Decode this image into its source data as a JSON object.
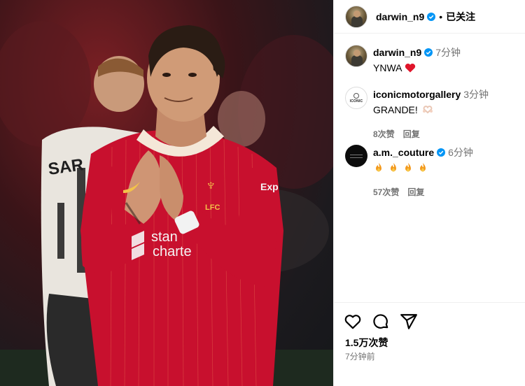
{
  "header": {
    "username": "darwin_n9",
    "separator": "•",
    "follow_state": "已关注"
  },
  "comments": [
    {
      "username": "darwin_n9",
      "time": "7分钟",
      "text": "YNWA",
      "emoji": "red-heart-icon"
    },
    {
      "username": "iconicmotorgallery",
      "time": "3分钟",
      "text": "GRANDE!",
      "emoji": "heart-hands-icon",
      "avatar_text": "ICONIC",
      "likes": "8次赞",
      "reply": "回复"
    },
    {
      "username": "a.m._couture",
      "time": "6分钟",
      "emoji": "fire-icon x4",
      "likes": "57次赞",
      "reply": "回复"
    }
  ],
  "footer": {
    "likes": "1.5万次赞",
    "time": "7分钟前"
  },
  "photo": {
    "shirt_text_1": "stan",
    "shirt_text_2": "charte",
    "sponsor_sleeve": "Exp",
    "crest_text": "LFC",
    "opponent_back": "SAR"
  },
  "colors": {
    "verified": "#0095f6",
    "liverpool_red": "#c8102e"
  }
}
